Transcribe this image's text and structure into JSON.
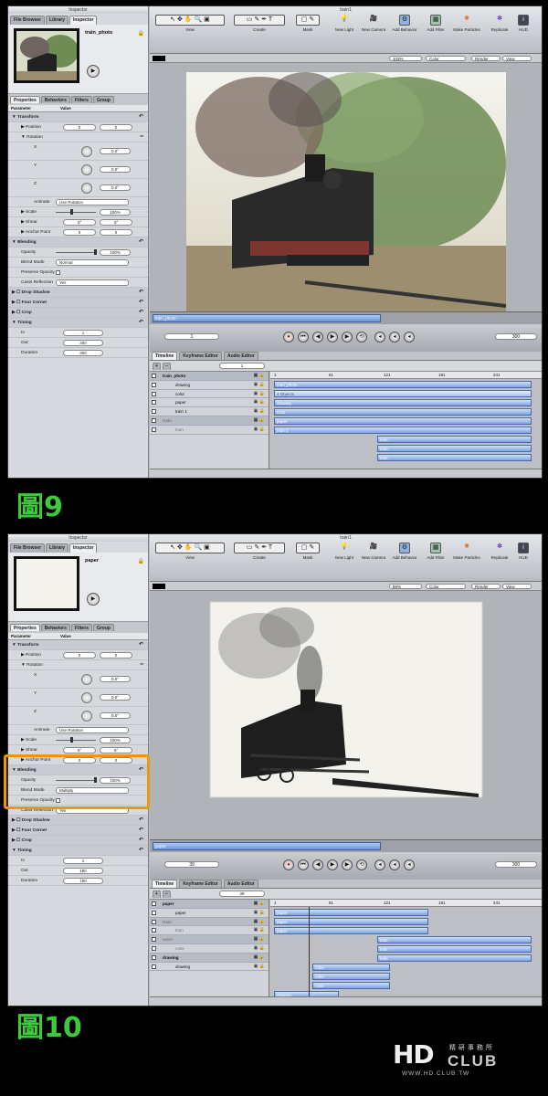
{
  "screenshots": [
    {
      "id": "fig9",
      "caption": "圖9",
      "window_title": "train1",
      "inspector": {
        "title": "Inspector",
        "top_tabs": [
          "File Browser",
          "Library",
          "Inspector"
        ],
        "selected_name": "train_photo",
        "param_tabs": [
          "Properties",
          "Behaviors",
          "Filters",
          "Group"
        ],
        "header": {
          "param": "Parameter",
          "value": "Value"
        },
        "transform": "Transform",
        "position": {
          "label": "Position",
          "x": "0",
          "y": "0"
        },
        "rotation": "Rotation",
        "x": {
          "label": "X",
          "value": "0.0°"
        },
        "y": {
          "label": "Y",
          "value": "0.0°"
        },
        "z": {
          "label": "Z",
          "value": "0.0°"
        },
        "animate": {
          "label": "Animate",
          "value": "Use Rotation"
        },
        "scale": {
          "label": "Scale",
          "value": "100%"
        },
        "shear": {
          "label": "Shear",
          "x": "0°",
          "y": "0°"
        },
        "anchor": {
          "label": "Anchor Point",
          "x": "0",
          "y": "0"
        },
        "blending": "Blending",
        "opacity": {
          "label": "Opacity",
          "value": "100%"
        },
        "blend_mode": {
          "label": "Blend Mode",
          "value": "Normal"
        },
        "preserve_opacity": "Preserve Opacity",
        "casts_reflection": {
          "label": "Casts Reflection",
          "value": "Yes"
        },
        "drop_shadow": "Drop Shadow",
        "four_corner": "Four Corner",
        "crop": "Crop",
        "timing": "Timing",
        "in": {
          "label": "In",
          "value": "1"
        },
        "out": {
          "label": "Out",
          "value": "300"
        },
        "duration": {
          "label": "Duration",
          "value": "300"
        }
      },
      "toolbar": {
        "view": "View",
        "create": "Create",
        "mask": "Mask",
        "new_light": "New Light",
        "new_camera": "New Camera",
        "add_behavior": "Add Behavior",
        "add_filter": "Add Filter",
        "make_particles": "Make Particles",
        "replicate": "Replicate",
        "hud": "HUD"
      },
      "canvas_strip": {
        "zoom": "103%",
        "color": "Color",
        "render": "Render",
        "view": "View"
      },
      "mini_timeline_label": "train_photo",
      "transport": {
        "frame": "1",
        "end": "300"
      },
      "timeline_tabs": [
        "Timeline",
        "Keyframe Editor",
        "Audio Editor"
      ],
      "timeline_frame": "1",
      "ruler": [
        "1",
        "61",
        "121",
        "181",
        "241"
      ],
      "layers": [
        {
          "name": "train_photo",
          "type": "group"
        },
        {
          "name": "drawing",
          "type": "layer"
        },
        {
          "name": "color",
          "type": "layer"
        },
        {
          "name": "paper",
          "type": "layer"
        },
        {
          "name": "train 1",
          "type": "layer"
        },
        {
          "name": "train",
          "type": "group-dim"
        },
        {
          "name": "train",
          "type": "layer-dim"
        }
      ],
      "tracks": [
        {
          "label": "train_photo",
          "start": 0,
          "end": 1,
          "row": 0
        },
        {
          "label": "4 Objects",
          "start": 0,
          "end": 1,
          "row": 1,
          "hd": true
        },
        {
          "label": "drawing",
          "start": 0,
          "end": 1,
          "row": 2
        },
        {
          "label": "color",
          "start": 0,
          "end": 1,
          "row": 3
        },
        {
          "label": "paper",
          "start": 0,
          "end": 1,
          "row": 4
        },
        {
          "label": "train 1",
          "start": 0,
          "end": 1,
          "row": 5
        },
        {
          "label": "train",
          "start": 0.4,
          "end": 1,
          "row": 6
        },
        {
          "label": "train",
          "start": 0.4,
          "end": 1,
          "row": 7
        },
        {
          "label": "train",
          "start": 0.4,
          "end": 1,
          "row": 8
        }
      ]
    },
    {
      "id": "fig10",
      "caption": "圖10",
      "window_title": "train1",
      "inspector": {
        "title": "Inspector",
        "top_tabs": [
          "File Browser",
          "Library",
          "Inspector"
        ],
        "selected_name": "paper",
        "param_tabs": [
          "Properties",
          "Behaviors",
          "Filters",
          "Group"
        ],
        "header": {
          "param": "Parameter",
          "value": "Value"
        },
        "transform": "Transform",
        "position": {
          "label": "Position",
          "x": "0",
          "y": "0"
        },
        "rotation": "Rotation",
        "x": {
          "label": "X",
          "value": "0.0°"
        },
        "y": {
          "label": "Y",
          "value": "0.0°"
        },
        "z": {
          "label": "Z",
          "value": "0.0°"
        },
        "animate": {
          "label": "Animate",
          "value": "Use Rotation"
        },
        "scale": {
          "label": "Scale",
          "value": "100%"
        },
        "shear": {
          "label": "Shear",
          "x": "0°",
          "y": "0°"
        },
        "anchor": {
          "label": "Anchor Point",
          "x": "0",
          "y": "0"
        },
        "blending": "Blending",
        "opacity": {
          "label": "Opacity",
          "value": "100%"
        },
        "blend_mode": {
          "label": "Blend Mode",
          "value": "Multiply"
        },
        "preserve_opacity": "Preserve Opacity",
        "casts_reflection": {
          "label": "Casts Reflection",
          "value": "Yes"
        },
        "drop_shadow": "Drop Shadow",
        "four_corner": "Four Corner",
        "crop": "Crop",
        "timing": "Timing",
        "in": {
          "label": "In",
          "value": "1"
        },
        "out": {
          "label": "Out",
          "value": "180"
        },
        "duration": {
          "label": "Duration",
          "value": "180"
        }
      },
      "toolbar": {
        "view": "View",
        "create": "Create",
        "mask": "Mask",
        "new_light": "New Light",
        "new_camera": "New Camera",
        "add_behavior": "Add Behavior",
        "add_filter": "Add Filter",
        "make_particles": "Make Particles",
        "replicate": "Replicate",
        "hud": "HUD"
      },
      "canvas_strip": {
        "zoom": "88%",
        "color": "Color",
        "render": "Render",
        "view": "View"
      },
      "mini_timeline_label": "paper",
      "transport": {
        "frame": "39",
        "end": "300"
      },
      "timeline_tabs": [
        "Timeline",
        "Keyframe Editor",
        "Audio Editor"
      ],
      "timeline_frame": "39",
      "ruler": [
        "1",
        "61",
        "121",
        "181",
        "241"
      ],
      "layers": [
        {
          "name": "paper",
          "type": "group"
        },
        {
          "name": "paper",
          "type": "layer"
        },
        {
          "name": "train",
          "type": "group-dim"
        },
        {
          "name": "train",
          "type": "layer-dim"
        },
        {
          "name": "color",
          "type": "group-dim"
        },
        {
          "name": "color",
          "type": "layer-dim"
        },
        {
          "name": "drawing",
          "type": "group"
        },
        {
          "name": "drawing",
          "type": "layer"
        }
      ],
      "tracks": [
        {
          "label": "paper",
          "start": 0,
          "end": 0.6,
          "row": 0
        },
        {
          "label": "paper",
          "start": 0,
          "end": 0.6,
          "row": 1
        },
        {
          "label": "paper",
          "start": 0,
          "end": 0.6,
          "row": 2
        },
        {
          "label": "train",
          "start": 0.4,
          "end": 1,
          "row": 3
        },
        {
          "label": "train",
          "start": 0.4,
          "end": 1,
          "row": 4
        },
        {
          "label": "train",
          "start": 0.4,
          "end": 1,
          "row": 5
        },
        {
          "label": "color",
          "start": 0.15,
          "end": 0.45,
          "row": 6
        },
        {
          "label": "color",
          "start": 0.15,
          "end": 0.45,
          "row": 7
        },
        {
          "label": "color",
          "start": 0.15,
          "end": 0.45,
          "row": 8
        },
        {
          "label": "drawing",
          "start": 0,
          "end": 0.25,
          "row": 9
        },
        {
          "label": "drawing",
          "start": 0,
          "end": 0.25,
          "row": 10
        },
        {
          "label": "drawing",
          "start": 0,
          "end": 0.25,
          "row": 11
        }
      ]
    }
  ],
  "logo": {
    "hd": "HD",
    "club": "CLUB",
    "chinese": "精研事務所",
    "url": "WWW.HD.CLUB.TW"
  }
}
